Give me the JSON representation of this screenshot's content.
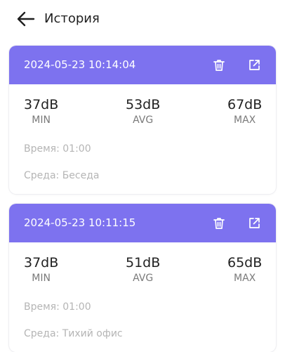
{
  "header": {
    "title": "История"
  },
  "records": [
    {
      "datetime": "2024-05-23 10:14:04",
      "min": {
        "value": "37dB",
        "label": "MIN"
      },
      "avg": {
        "value": "53dB",
        "label": "AVG"
      },
      "max": {
        "value": "67dB",
        "label": "MAX"
      },
      "time": "Время: 01:00",
      "environment": "Среда: Беседа"
    },
    {
      "datetime": "2024-05-23 10:11:15",
      "min": {
        "value": "37dB",
        "label": "MIN"
      },
      "avg": {
        "value": "51dB",
        "label": "AVG"
      },
      "max": {
        "value": "65dB",
        "label": "MAX"
      },
      "time": "Время: 01:00",
      "environment": "Среда: Тихий офис"
    }
  ],
  "colors": {
    "card_header": "#7d72ef",
    "meta_text": "#b5b5b5"
  }
}
